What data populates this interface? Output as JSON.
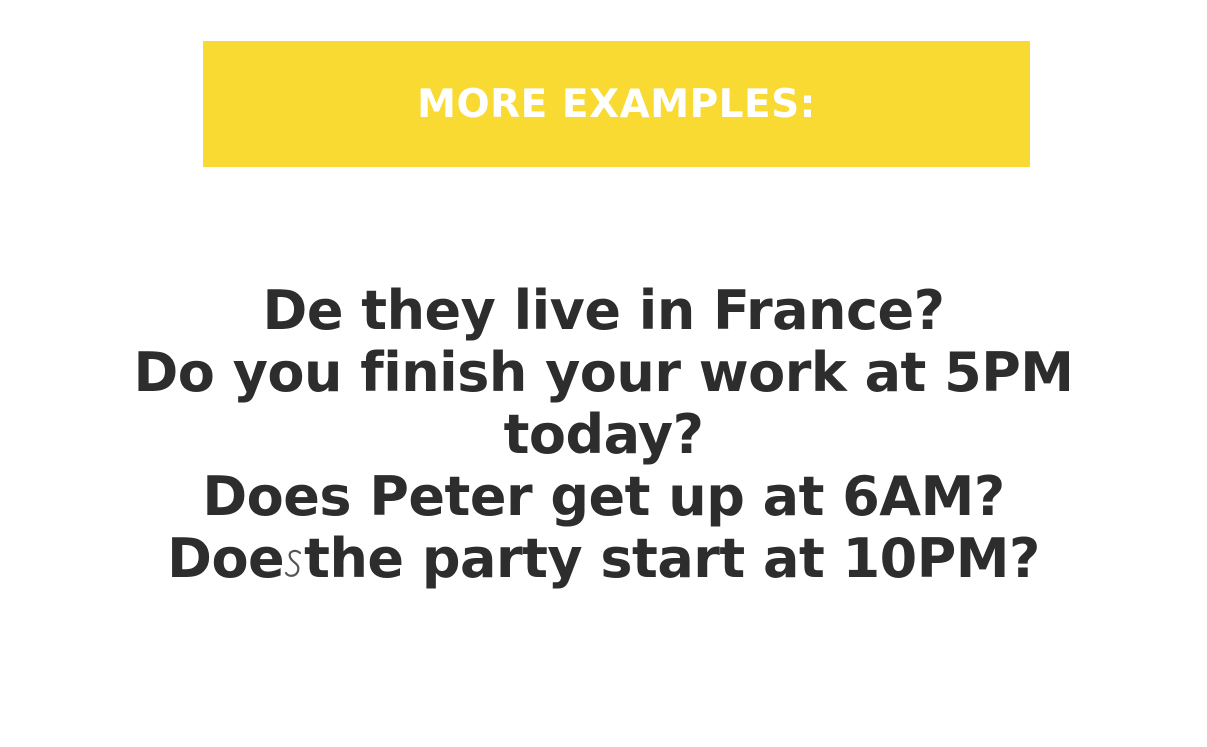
{
  "banner": {
    "title": "MORE EXAMPLES:"
  },
  "examples": [
    "De they live in France?",
    "Do you finish your work at 5PM",
    "today?",
    "Does Peter get up at 6AM?"
  ],
  "last_example": {
    "before": "Doe",
    "after": "the party start at 10PM?",
    "scribble_icon": "handwritten-s-icon"
  },
  "colors": {
    "banner": "#f8da33",
    "banner_text": "#ffffff",
    "body_text": "#2d2d2d",
    "scribble": "#555555"
  }
}
